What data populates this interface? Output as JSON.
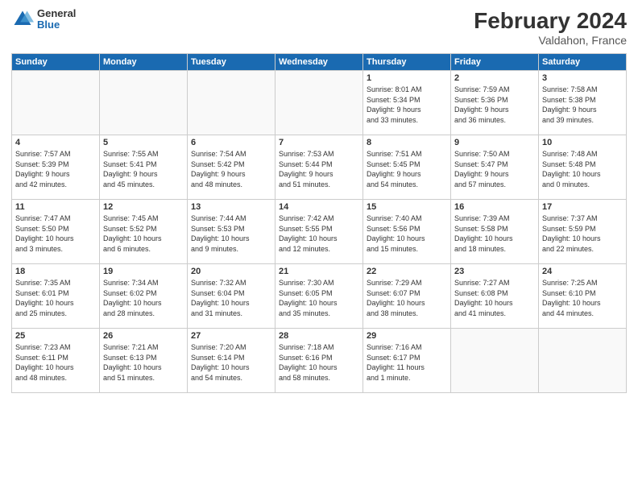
{
  "header": {
    "logo_general": "General",
    "logo_blue": "Blue",
    "title": "February 2024",
    "location": "Valdahon, France"
  },
  "weekdays": [
    "Sunday",
    "Monday",
    "Tuesday",
    "Wednesday",
    "Thursday",
    "Friday",
    "Saturday"
  ],
  "weeks": [
    [
      {
        "day": "",
        "info": ""
      },
      {
        "day": "",
        "info": ""
      },
      {
        "day": "",
        "info": ""
      },
      {
        "day": "",
        "info": ""
      },
      {
        "day": "1",
        "info": "Sunrise: 8:01 AM\nSunset: 5:34 PM\nDaylight: 9 hours\nand 33 minutes."
      },
      {
        "day": "2",
        "info": "Sunrise: 7:59 AM\nSunset: 5:36 PM\nDaylight: 9 hours\nand 36 minutes."
      },
      {
        "day": "3",
        "info": "Sunrise: 7:58 AM\nSunset: 5:38 PM\nDaylight: 9 hours\nand 39 minutes."
      }
    ],
    [
      {
        "day": "4",
        "info": "Sunrise: 7:57 AM\nSunset: 5:39 PM\nDaylight: 9 hours\nand 42 minutes."
      },
      {
        "day": "5",
        "info": "Sunrise: 7:55 AM\nSunset: 5:41 PM\nDaylight: 9 hours\nand 45 minutes."
      },
      {
        "day": "6",
        "info": "Sunrise: 7:54 AM\nSunset: 5:42 PM\nDaylight: 9 hours\nand 48 minutes."
      },
      {
        "day": "7",
        "info": "Sunrise: 7:53 AM\nSunset: 5:44 PM\nDaylight: 9 hours\nand 51 minutes."
      },
      {
        "day": "8",
        "info": "Sunrise: 7:51 AM\nSunset: 5:45 PM\nDaylight: 9 hours\nand 54 minutes."
      },
      {
        "day": "9",
        "info": "Sunrise: 7:50 AM\nSunset: 5:47 PM\nDaylight: 9 hours\nand 57 minutes."
      },
      {
        "day": "10",
        "info": "Sunrise: 7:48 AM\nSunset: 5:48 PM\nDaylight: 10 hours\nand 0 minutes."
      }
    ],
    [
      {
        "day": "11",
        "info": "Sunrise: 7:47 AM\nSunset: 5:50 PM\nDaylight: 10 hours\nand 3 minutes."
      },
      {
        "day": "12",
        "info": "Sunrise: 7:45 AM\nSunset: 5:52 PM\nDaylight: 10 hours\nand 6 minutes."
      },
      {
        "day": "13",
        "info": "Sunrise: 7:44 AM\nSunset: 5:53 PM\nDaylight: 10 hours\nand 9 minutes."
      },
      {
        "day": "14",
        "info": "Sunrise: 7:42 AM\nSunset: 5:55 PM\nDaylight: 10 hours\nand 12 minutes."
      },
      {
        "day": "15",
        "info": "Sunrise: 7:40 AM\nSunset: 5:56 PM\nDaylight: 10 hours\nand 15 minutes."
      },
      {
        "day": "16",
        "info": "Sunrise: 7:39 AM\nSunset: 5:58 PM\nDaylight: 10 hours\nand 18 minutes."
      },
      {
        "day": "17",
        "info": "Sunrise: 7:37 AM\nSunset: 5:59 PM\nDaylight: 10 hours\nand 22 minutes."
      }
    ],
    [
      {
        "day": "18",
        "info": "Sunrise: 7:35 AM\nSunset: 6:01 PM\nDaylight: 10 hours\nand 25 minutes."
      },
      {
        "day": "19",
        "info": "Sunrise: 7:34 AM\nSunset: 6:02 PM\nDaylight: 10 hours\nand 28 minutes."
      },
      {
        "day": "20",
        "info": "Sunrise: 7:32 AM\nSunset: 6:04 PM\nDaylight: 10 hours\nand 31 minutes."
      },
      {
        "day": "21",
        "info": "Sunrise: 7:30 AM\nSunset: 6:05 PM\nDaylight: 10 hours\nand 35 minutes."
      },
      {
        "day": "22",
        "info": "Sunrise: 7:29 AM\nSunset: 6:07 PM\nDaylight: 10 hours\nand 38 minutes."
      },
      {
        "day": "23",
        "info": "Sunrise: 7:27 AM\nSunset: 6:08 PM\nDaylight: 10 hours\nand 41 minutes."
      },
      {
        "day": "24",
        "info": "Sunrise: 7:25 AM\nSunset: 6:10 PM\nDaylight: 10 hours\nand 44 minutes."
      }
    ],
    [
      {
        "day": "25",
        "info": "Sunrise: 7:23 AM\nSunset: 6:11 PM\nDaylight: 10 hours\nand 48 minutes."
      },
      {
        "day": "26",
        "info": "Sunrise: 7:21 AM\nSunset: 6:13 PM\nDaylight: 10 hours\nand 51 minutes."
      },
      {
        "day": "27",
        "info": "Sunrise: 7:20 AM\nSunset: 6:14 PM\nDaylight: 10 hours\nand 54 minutes."
      },
      {
        "day": "28",
        "info": "Sunrise: 7:18 AM\nSunset: 6:16 PM\nDaylight: 10 hours\nand 58 minutes."
      },
      {
        "day": "29",
        "info": "Sunrise: 7:16 AM\nSunset: 6:17 PM\nDaylight: 11 hours\nand 1 minute."
      },
      {
        "day": "",
        "info": ""
      },
      {
        "day": "",
        "info": ""
      }
    ]
  ]
}
